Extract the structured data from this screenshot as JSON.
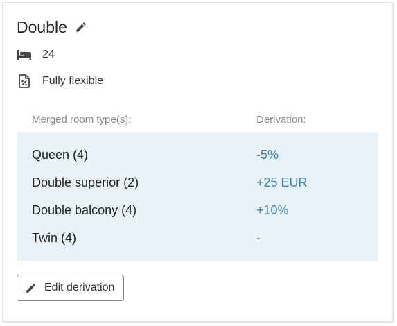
{
  "room": {
    "title": "Double",
    "title_edit_icon": "pencil-icon",
    "beds_icon": "bed-icon",
    "beds": "24",
    "policy_icon": "percent-document-icon",
    "policy": "Fully flexible"
  },
  "merged": {
    "header_room_types": "Merged room type(s):",
    "header_derivation": "Derivation:",
    "rows": [
      {
        "name": "Queen (4)",
        "derivation": "-5%"
      },
      {
        "name": "Double superior (2)",
        "derivation": "+25 EUR"
      },
      {
        "name": "Double balcony (4)",
        "derivation": "+10%"
      },
      {
        "name": "Twin (4)",
        "derivation": "-"
      }
    ]
  },
  "actions": {
    "edit_icon": "pencil-icon",
    "edit_label": "Edit derivation"
  },
  "colors": {
    "panel_bg": "#e9f2f7",
    "derivation_accent": "#3a84b5",
    "card_border": "#e4e4e4"
  }
}
